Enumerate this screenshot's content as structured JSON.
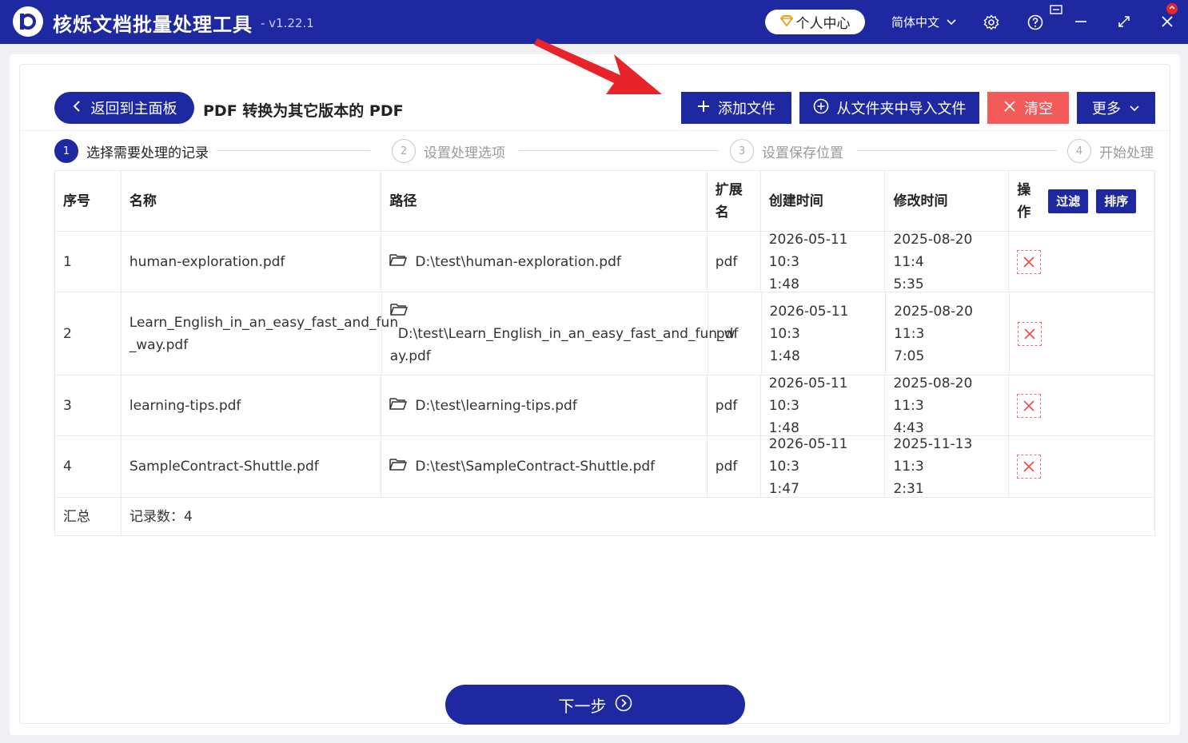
{
  "app": {
    "title": "核烁文档批量处理工具",
    "version": "- v1.22.1",
    "user_center": "个人中心",
    "language": "简体中文"
  },
  "toolbar": {
    "back_label": "返回到主面板",
    "page_title": "PDF 转换为其它版本的 PDF",
    "add_file": "添加文件",
    "import_folder": "从文件夹中导入文件",
    "clear": "清空",
    "more": "更多"
  },
  "steps": [
    {
      "num": "1",
      "label": "选择需要处理的记录",
      "active": true
    },
    {
      "num": "2",
      "label": "设置处理选项",
      "active": false
    },
    {
      "num": "3",
      "label": "设置保存位置",
      "active": false
    },
    {
      "num": "4",
      "label": "开始处理",
      "active": false
    }
  ],
  "table": {
    "headers": {
      "idx": "序号",
      "name": "名称",
      "path": "路径",
      "ext_line1": "扩展",
      "ext_line2": "名",
      "ctime": "创建时间",
      "mtime": "修改时间",
      "op_line1": "操",
      "op_line2": "作",
      "filter": "过滤",
      "sort": "排序"
    },
    "rows": [
      {
        "idx": "1",
        "name_l1": "human-exploration.pdf",
        "name_l2": "",
        "path_l1": "D:\\test\\human-exploration.pdf",
        "path_l2": "",
        "ext": "pdf",
        "ctime_l1": "2026-05-11 10:3",
        "ctime_l2": "1:48",
        "mtime_l1": "2025-08-20 11:4",
        "mtime_l2": "5:35"
      },
      {
        "idx": "2",
        "name_l1": "Learn_English_in_an_easy_fast_and_fun",
        "name_l2": "_way.pdf",
        "path_l1": "D:\\test\\Learn_English_in_an_easy_fast_and_fun_w",
        "path_l2": "ay.pdf",
        "ext": "pdf",
        "ctime_l1": "2026-05-11 10:3",
        "ctime_l2": "1:48",
        "mtime_l1": "2025-08-20 11:3",
        "mtime_l2": "7:05"
      },
      {
        "idx": "3",
        "name_l1": "learning-tips.pdf",
        "name_l2": "",
        "path_l1": "D:\\test\\learning-tips.pdf",
        "path_l2": "",
        "ext": "pdf",
        "ctime_l1": "2026-05-11 10:3",
        "ctime_l2": "1:48",
        "mtime_l1": "2025-08-20 11:3",
        "mtime_l2": "4:43"
      },
      {
        "idx": "4",
        "name_l1": "SampleContract-Shuttle.pdf",
        "name_l2": "",
        "path_l1": "D:\\test\\SampleContract-Shuttle.pdf",
        "path_l2": "",
        "ext": "pdf",
        "ctime_l1": "2026-05-11 10:3",
        "ctime_l2": "1:47",
        "mtime_l1": "2025-11-13 11:3",
        "mtime_l2": "2:31"
      }
    ],
    "summary": {
      "label": "汇总",
      "count_text": "记录数：4"
    }
  },
  "next_button": "下一步",
  "colors": {
    "primary": "#1e28a0",
    "danger": "#f45a5a",
    "annotation_arrow": "#e8242a"
  },
  "icons": [
    "app-logo",
    "diamond-icon",
    "chevron-down-icon",
    "gear-icon",
    "help-icon",
    "message-icon",
    "minimize-icon",
    "maximize-icon",
    "close-icon",
    "chevron-left-icon",
    "plus-icon",
    "plus-circle-icon",
    "x-icon",
    "folder-icon",
    "delete-icon",
    "arrow-circle-right-icon"
  ]
}
